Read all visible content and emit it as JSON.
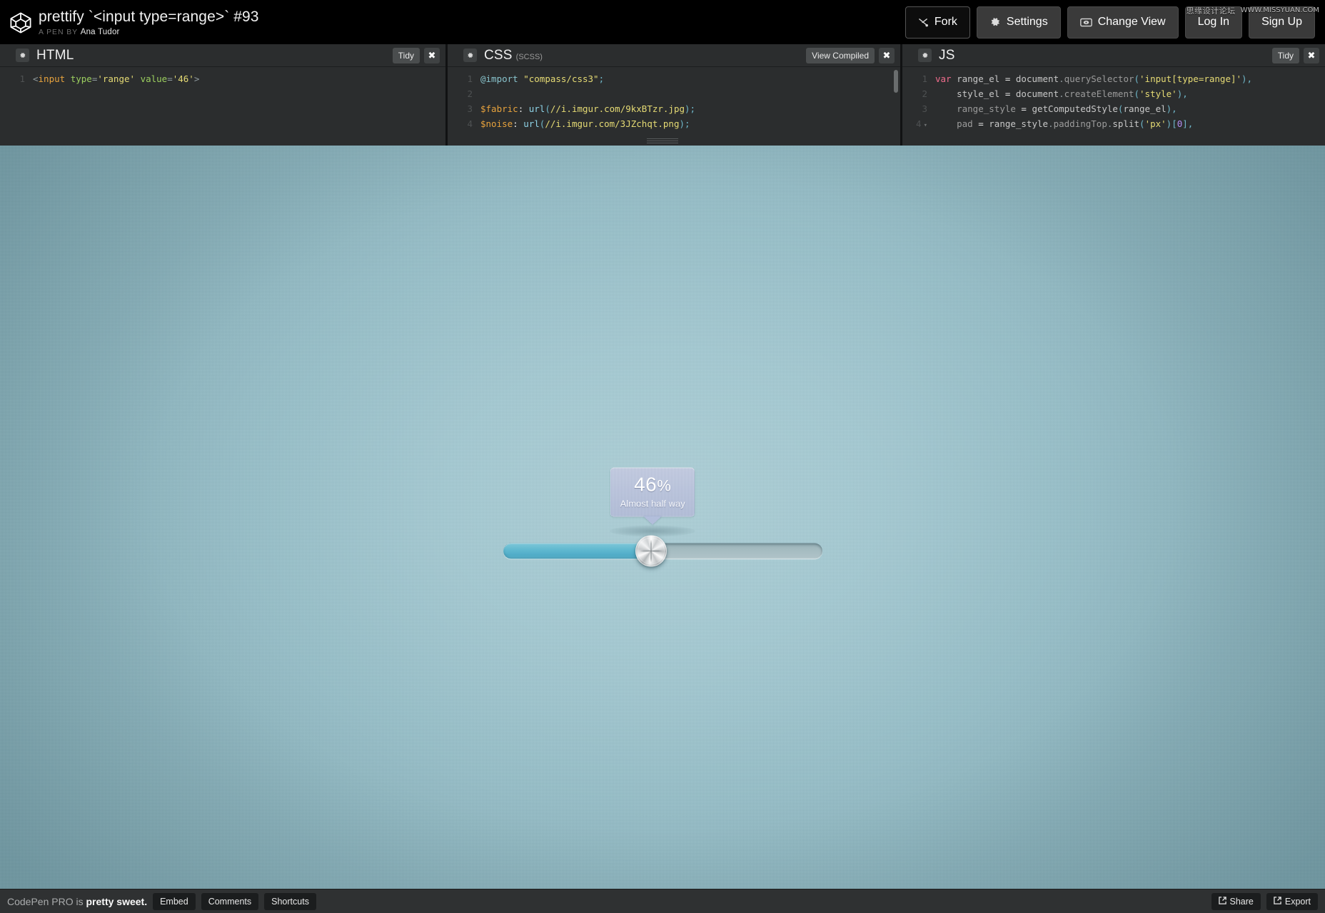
{
  "topbar": {
    "logo_icon": "codepen-logo-icon",
    "pen_title": "prettify `<input type=range>` #93",
    "byline_prefix": "A PEN BY",
    "author": "Ana Tudor",
    "buttons": [
      {
        "label": "Fork",
        "icon": "fork-icon",
        "style": "dark"
      },
      {
        "label": "Settings",
        "icon": "gear-icon",
        "style": "grey"
      },
      {
        "label": "Change View",
        "icon": "view-icon",
        "style": "grey"
      },
      {
        "label": "Log In",
        "icon": "",
        "style": "grey"
      },
      {
        "label": "Sign Up",
        "icon": "",
        "style": "grey"
      }
    ],
    "watermark_cn": "思缘设计论坛",
    "watermark_en": "WWW.MISSYUAN.COM"
  },
  "editors": [
    {
      "id": "html",
      "title": "HTML",
      "subtitle": "",
      "action_label": "Tidy",
      "close_label": "✖",
      "gear_icon": "gear-icon",
      "lines": [
        {
          "number": "1",
          "fold": false,
          "tokens": [
            {
              "t": "t-punc",
              "s": "<"
            },
            {
              "t": "t-tag",
              "s": "input"
            },
            {
              "t": "t-plain",
              "s": " "
            },
            {
              "t": "t-attr",
              "s": "type"
            },
            {
              "t": "t-punc",
              "s": "="
            },
            {
              "t": "t-str",
              "s": "'range'"
            },
            {
              "t": "t-plain",
              "s": " "
            },
            {
              "t": "t-attr",
              "s": "value"
            },
            {
              "t": "t-punc",
              "s": "="
            },
            {
              "t": "t-str",
              "s": "'46'"
            },
            {
              "t": "t-punc",
              "s": ">"
            }
          ]
        }
      ]
    },
    {
      "id": "css",
      "title": "CSS",
      "subtitle": "(SCSS)",
      "action_label": "View Compiled",
      "close_label": "✖",
      "gear_icon": "gear-icon",
      "lines": [
        {
          "number": "1",
          "fold": false,
          "tokens": [
            {
              "t": "t-at",
              "s": "@import"
            },
            {
              "t": "t-plain",
              "s": " "
            },
            {
              "t": "t-str",
              "s": "\"compass/css3\""
            },
            {
              "t": "t-semi",
              "s": ";"
            }
          ]
        },
        {
          "number": "2",
          "fold": false,
          "tokens": []
        },
        {
          "number": "3",
          "fold": false,
          "tokens": [
            {
              "t": "t-sel",
              "s": "$fabric"
            },
            {
              "t": "t-plain",
              "s": ": "
            },
            {
              "t": "t-fn",
              "s": "url"
            },
            {
              "t": "t-semi",
              "s": "("
            },
            {
              "t": "t-str",
              "s": "//i.imgur.com/9kxBTzr.jpg"
            },
            {
              "t": "t-semi",
              "s": ");"
            }
          ]
        },
        {
          "number": "4",
          "fold": false,
          "tokens": [
            {
              "t": "t-sel",
              "s": "$noise"
            },
            {
              "t": "t-plain",
              "s": ": "
            },
            {
              "t": "t-fn",
              "s": "url"
            },
            {
              "t": "t-semi",
              "s": "("
            },
            {
              "t": "t-str",
              "s": "//i.imgur.com/3JZchqt.png"
            },
            {
              "t": "t-semi",
              "s": ");"
            }
          ]
        }
      ]
    },
    {
      "id": "js",
      "title": "JS",
      "subtitle": "",
      "action_label": "Tidy",
      "close_label": "✖",
      "gear_icon": "gear-icon",
      "lines": [
        {
          "number": "1",
          "fold": false,
          "tokens": [
            {
              "t": "t-kw",
              "s": "var"
            },
            {
              "t": "t-plain",
              "s": " "
            },
            {
              "t": "t-var",
              "s": "range_el"
            },
            {
              "t": "t-plain",
              "s": " = "
            },
            {
              "t": "t-var",
              "s": "document"
            },
            {
              "t": "t-punc",
              "s": "."
            },
            {
              "t": "t-prop",
              "s": "querySelector"
            },
            {
              "t": "t-semi",
              "s": "("
            },
            {
              "t": "t-str",
              "s": "'input[type=range]'"
            },
            {
              "t": "t-semi",
              "s": "),"
            }
          ]
        },
        {
          "number": "2",
          "fold": false,
          "tokens": [
            {
              "t": "t-plain",
              "s": "    "
            },
            {
              "t": "t-var",
              "s": "style_el"
            },
            {
              "t": "t-plain",
              "s": " = "
            },
            {
              "t": "t-var",
              "s": "document"
            },
            {
              "t": "t-punc",
              "s": "."
            },
            {
              "t": "t-prop",
              "s": "createElement"
            },
            {
              "t": "t-semi",
              "s": "("
            },
            {
              "t": "t-str",
              "s": "'style'"
            },
            {
              "t": "t-semi",
              "s": "),"
            }
          ]
        },
        {
          "number": "3",
          "fold": false,
          "tokens": [
            {
              "t": "t-plain",
              "s": "    "
            },
            {
              "t": "t-prop",
              "s": "range_style"
            },
            {
              "t": "t-plain",
              "s": " = "
            },
            {
              "t": "t-var",
              "s": "getComputedStyle"
            },
            {
              "t": "t-semi",
              "s": "("
            },
            {
              "t": "t-var",
              "s": "range_el"
            },
            {
              "t": "t-semi",
              "s": "),"
            }
          ]
        },
        {
          "number": "4",
          "fold": true,
          "tokens": [
            {
              "t": "t-plain",
              "s": "    "
            },
            {
              "t": "t-prop",
              "s": "pad"
            },
            {
              "t": "t-plain",
              "s": " = "
            },
            {
              "t": "t-var",
              "s": "range_style"
            },
            {
              "t": "t-punc",
              "s": "."
            },
            {
              "t": "t-prop",
              "s": "paddingTop"
            },
            {
              "t": "t-punc",
              "s": "."
            },
            {
              "t": "t-var",
              "s": "split"
            },
            {
              "t": "t-semi",
              "s": "("
            },
            {
              "t": "t-str",
              "s": "'px'"
            },
            {
              "t": "t-semi",
              "s": ")["
            },
            {
              "t": "t-num",
              "s": "0"
            },
            {
              "t": "t-semi",
              "s": "],"
            }
          ]
        }
      ]
    }
  ],
  "preview": {
    "range_value": 46,
    "range_min": 0,
    "range_max": 100,
    "tooltip_value": "46",
    "tooltip_percent_sign": "%",
    "tooltip_label": "Almost half way",
    "colors": {
      "background_center": "#afd2da",
      "background_edge": "#7aa4ae",
      "track_empty": "#a6bdc2",
      "track_fill": "#45aecd",
      "tooltip_bg": "#bcc7e1",
      "tooltip_text": "#ffffff",
      "thumb_metal": "#e9ebec"
    }
  },
  "footer": {
    "promo_prefix": "CodePen PRO is ",
    "promo_strong": "pretty sweet.",
    "left_buttons": [
      {
        "label": "Embed"
      },
      {
        "label": "Comments"
      },
      {
        "label": "Shortcuts"
      }
    ],
    "right_buttons": [
      {
        "label": "Share",
        "icon": "external-link-icon"
      },
      {
        "label": "Export",
        "icon": "external-link-icon"
      }
    ]
  }
}
